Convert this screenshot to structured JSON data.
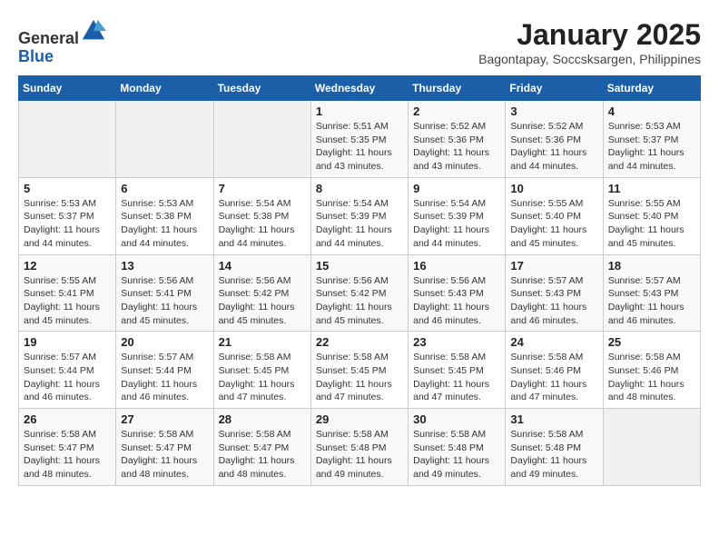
{
  "header": {
    "logo_line1": "General",
    "logo_line2": "Blue",
    "month_title": "January 2025",
    "location": "Bagontapay, Soccsksargen, Philippines"
  },
  "weekdays": [
    "Sunday",
    "Monday",
    "Tuesday",
    "Wednesday",
    "Thursday",
    "Friday",
    "Saturday"
  ],
  "weeks": [
    [
      {
        "day": "",
        "sunrise": "",
        "sunset": "",
        "daylight": ""
      },
      {
        "day": "",
        "sunrise": "",
        "sunset": "",
        "daylight": ""
      },
      {
        "day": "",
        "sunrise": "",
        "sunset": "",
        "daylight": ""
      },
      {
        "day": "1",
        "sunrise": "Sunrise: 5:51 AM",
        "sunset": "Sunset: 5:35 PM",
        "daylight": "Daylight: 11 hours and 43 minutes."
      },
      {
        "day": "2",
        "sunrise": "Sunrise: 5:52 AM",
        "sunset": "Sunset: 5:36 PM",
        "daylight": "Daylight: 11 hours and 43 minutes."
      },
      {
        "day": "3",
        "sunrise": "Sunrise: 5:52 AM",
        "sunset": "Sunset: 5:36 PM",
        "daylight": "Daylight: 11 hours and 44 minutes."
      },
      {
        "day": "4",
        "sunrise": "Sunrise: 5:53 AM",
        "sunset": "Sunset: 5:37 PM",
        "daylight": "Daylight: 11 hours and 44 minutes."
      }
    ],
    [
      {
        "day": "5",
        "sunrise": "Sunrise: 5:53 AM",
        "sunset": "Sunset: 5:37 PM",
        "daylight": "Daylight: 11 hours and 44 minutes."
      },
      {
        "day": "6",
        "sunrise": "Sunrise: 5:53 AM",
        "sunset": "Sunset: 5:38 PM",
        "daylight": "Daylight: 11 hours and 44 minutes."
      },
      {
        "day": "7",
        "sunrise": "Sunrise: 5:54 AM",
        "sunset": "Sunset: 5:38 PM",
        "daylight": "Daylight: 11 hours and 44 minutes."
      },
      {
        "day": "8",
        "sunrise": "Sunrise: 5:54 AM",
        "sunset": "Sunset: 5:39 PM",
        "daylight": "Daylight: 11 hours and 44 minutes."
      },
      {
        "day": "9",
        "sunrise": "Sunrise: 5:54 AM",
        "sunset": "Sunset: 5:39 PM",
        "daylight": "Daylight: 11 hours and 44 minutes."
      },
      {
        "day": "10",
        "sunrise": "Sunrise: 5:55 AM",
        "sunset": "Sunset: 5:40 PM",
        "daylight": "Daylight: 11 hours and 45 minutes."
      },
      {
        "day": "11",
        "sunrise": "Sunrise: 5:55 AM",
        "sunset": "Sunset: 5:40 PM",
        "daylight": "Daylight: 11 hours and 45 minutes."
      }
    ],
    [
      {
        "day": "12",
        "sunrise": "Sunrise: 5:55 AM",
        "sunset": "Sunset: 5:41 PM",
        "daylight": "Daylight: 11 hours and 45 minutes."
      },
      {
        "day": "13",
        "sunrise": "Sunrise: 5:56 AM",
        "sunset": "Sunset: 5:41 PM",
        "daylight": "Daylight: 11 hours and 45 minutes."
      },
      {
        "day": "14",
        "sunrise": "Sunrise: 5:56 AM",
        "sunset": "Sunset: 5:42 PM",
        "daylight": "Daylight: 11 hours and 45 minutes."
      },
      {
        "day": "15",
        "sunrise": "Sunrise: 5:56 AM",
        "sunset": "Sunset: 5:42 PM",
        "daylight": "Daylight: 11 hours and 45 minutes."
      },
      {
        "day": "16",
        "sunrise": "Sunrise: 5:56 AM",
        "sunset": "Sunset: 5:43 PM",
        "daylight": "Daylight: 11 hours and 46 minutes."
      },
      {
        "day": "17",
        "sunrise": "Sunrise: 5:57 AM",
        "sunset": "Sunset: 5:43 PM",
        "daylight": "Daylight: 11 hours and 46 minutes."
      },
      {
        "day": "18",
        "sunrise": "Sunrise: 5:57 AM",
        "sunset": "Sunset: 5:43 PM",
        "daylight": "Daylight: 11 hours and 46 minutes."
      }
    ],
    [
      {
        "day": "19",
        "sunrise": "Sunrise: 5:57 AM",
        "sunset": "Sunset: 5:44 PM",
        "daylight": "Daylight: 11 hours and 46 minutes."
      },
      {
        "day": "20",
        "sunrise": "Sunrise: 5:57 AM",
        "sunset": "Sunset: 5:44 PM",
        "daylight": "Daylight: 11 hours and 46 minutes."
      },
      {
        "day": "21",
        "sunrise": "Sunrise: 5:58 AM",
        "sunset": "Sunset: 5:45 PM",
        "daylight": "Daylight: 11 hours and 47 minutes."
      },
      {
        "day": "22",
        "sunrise": "Sunrise: 5:58 AM",
        "sunset": "Sunset: 5:45 PM",
        "daylight": "Daylight: 11 hours and 47 minutes."
      },
      {
        "day": "23",
        "sunrise": "Sunrise: 5:58 AM",
        "sunset": "Sunset: 5:45 PM",
        "daylight": "Daylight: 11 hours and 47 minutes."
      },
      {
        "day": "24",
        "sunrise": "Sunrise: 5:58 AM",
        "sunset": "Sunset: 5:46 PM",
        "daylight": "Daylight: 11 hours and 47 minutes."
      },
      {
        "day": "25",
        "sunrise": "Sunrise: 5:58 AM",
        "sunset": "Sunset: 5:46 PM",
        "daylight": "Daylight: 11 hours and 48 minutes."
      }
    ],
    [
      {
        "day": "26",
        "sunrise": "Sunrise: 5:58 AM",
        "sunset": "Sunset: 5:47 PM",
        "daylight": "Daylight: 11 hours and 48 minutes."
      },
      {
        "day": "27",
        "sunrise": "Sunrise: 5:58 AM",
        "sunset": "Sunset: 5:47 PM",
        "daylight": "Daylight: 11 hours and 48 minutes."
      },
      {
        "day": "28",
        "sunrise": "Sunrise: 5:58 AM",
        "sunset": "Sunset: 5:47 PM",
        "daylight": "Daylight: 11 hours and 48 minutes."
      },
      {
        "day": "29",
        "sunrise": "Sunrise: 5:58 AM",
        "sunset": "Sunset: 5:48 PM",
        "daylight": "Daylight: 11 hours and 49 minutes."
      },
      {
        "day": "30",
        "sunrise": "Sunrise: 5:58 AM",
        "sunset": "Sunset: 5:48 PM",
        "daylight": "Daylight: 11 hours and 49 minutes."
      },
      {
        "day": "31",
        "sunrise": "Sunrise: 5:58 AM",
        "sunset": "Sunset: 5:48 PM",
        "daylight": "Daylight: 11 hours and 49 minutes."
      },
      {
        "day": "",
        "sunrise": "",
        "sunset": "",
        "daylight": ""
      }
    ]
  ]
}
